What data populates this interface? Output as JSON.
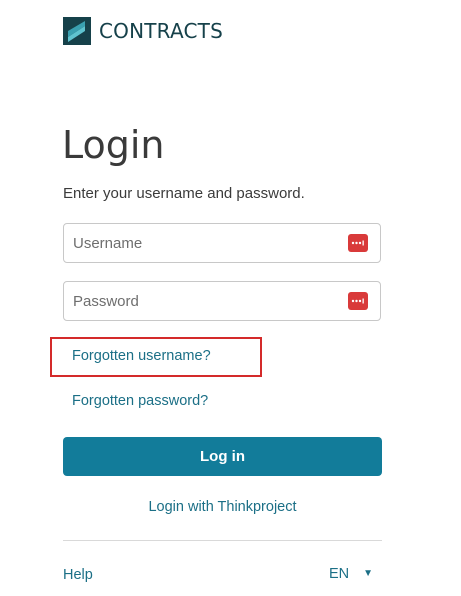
{
  "brand": {
    "name": "CONTRACTS",
    "logo_icon": "contracts-logo-icon",
    "colors": {
      "dark": "#16414a",
      "light": "#5fc3cf"
    }
  },
  "login": {
    "title": "Login",
    "instructions": "Enter your username and password.",
    "username": {
      "placeholder": "Username",
      "value": "",
      "icon": "password-manager-icon"
    },
    "password": {
      "placeholder": "Password",
      "value": "",
      "icon": "password-manager-icon"
    },
    "forgot_username": "Forgotten username?",
    "forgot_password": "Forgotten password?",
    "submit_label": "Log in",
    "sso_label": "Login with Thinkproject"
  },
  "footer": {
    "help_label": "Help",
    "language": "EN",
    "language_icon": "chevron-down-icon"
  },
  "colors": {
    "accent": "#127c9a",
    "link": "#1b6f86",
    "highlight": "#d42a2a",
    "password_manager": "#d93a3a"
  }
}
